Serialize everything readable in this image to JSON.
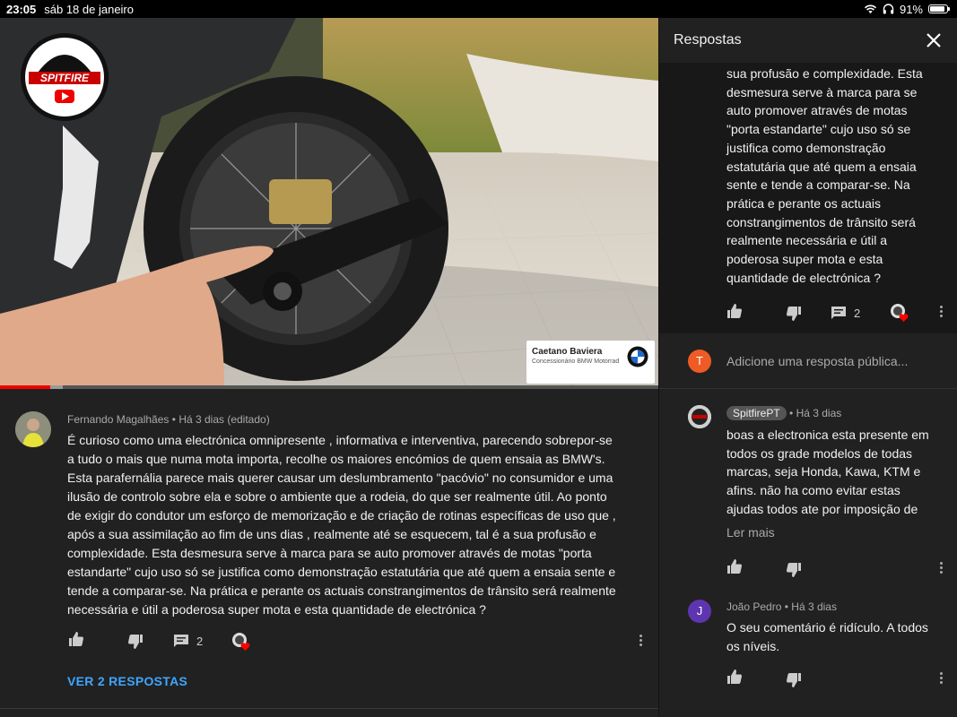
{
  "status_bar": {
    "time": "23:05",
    "date": "sáb 18 de janeiro",
    "battery": "91%",
    "battery_level": 0.91
  },
  "video": {
    "channel_logo_text": "SPITFIRE",
    "dealer_name": "Caetano Baviera",
    "dealer_subtitle": "Concessionário BMW Motorrad",
    "progress_played": 0.076
  },
  "comment": {
    "author": "Fernando Magalhães",
    "meta": "Há 3 dias (editado)",
    "text_lines": [
      "É curioso como uma electrónica omnipresente , informativa e interventiva, parecendo sobrepor-se",
      "a tudo o mais que numa mota importa, recolhe os maiores encómios de quem ensaia as BMW's.",
      "Esta parafernália parece mais querer causar um deslumbramento \"pacóvio\" no consumidor e uma",
      "ilusão de controlo sobre ela e sobre o  ambiente que a rodeia, do que ser realmente útil. Ao ponto",
      "de exigir do condutor um esforço de memorização e de criação de rotinas específicas de uso que ,",
      "após a sua assimilação ao fim de uns dias , realmente até se esquecem, tal é a sua profusão e",
      "complexidade. Esta desmesura serve à marca para se auto promover através de motas \"porta",
      "estandarte\" cujo uso só se justifica como demonstração estatutária que até quem a ensaia sente e",
      "tende a comparar-se. Na prática e perante os actuais constrangimentos de trânsito será realmente",
      "necessária e útil a poderosa super mota e esta quantidade de electrónica ?"
    ],
    "reply_count": "2",
    "view_replies": "VER 2 RESPOSTAS"
  },
  "panel": {
    "title": "Respostas",
    "parent_text_lines": [
      "sua profusão e complexidade. Esta",
      "desmesura serve à marca para se",
      "auto promover através de motas",
      "\"porta estandarte\" cujo uso só se",
      "justifica como demonstração",
      "estatutária que até quem a ensaia",
      "sente e tende a comparar-se. Na",
      "prática e perante os actuais",
      "constrangimentos de trânsito será",
      "realmente necessária e útil a",
      "poderosa super mota e esta",
      "quantidade de electrónica ?"
    ],
    "parent_reply_count": "2",
    "add_reply_avatar_letter": "T",
    "add_reply_placeholder": "Adicione uma resposta pública...",
    "replies": [
      {
        "author": "SpitfirePT",
        "meta": "Há 3 dias",
        "text_lines": [
          "boas a electronica esta presente em",
          "todos os grade modelos de todas",
          "marcas, seja Honda, Kawa, KTM e",
          "afins. não ha como evitar estas",
          "ajudas todos ate por imposição de"
        ],
        "read_more": "Ler mais"
      },
      {
        "author": "João Pedro",
        "avatar_letter": "J",
        "meta": "Há 3 dias",
        "text_lines": [
          "O seu comentário é ridículo. A todos",
          "os níveis."
        ]
      }
    ]
  },
  "colors": {
    "accent_link": "#3ea6ff",
    "progress_red": "#e00000",
    "avatar_orange": "#ef5b24",
    "avatar_purple": "#5e35b1"
  }
}
